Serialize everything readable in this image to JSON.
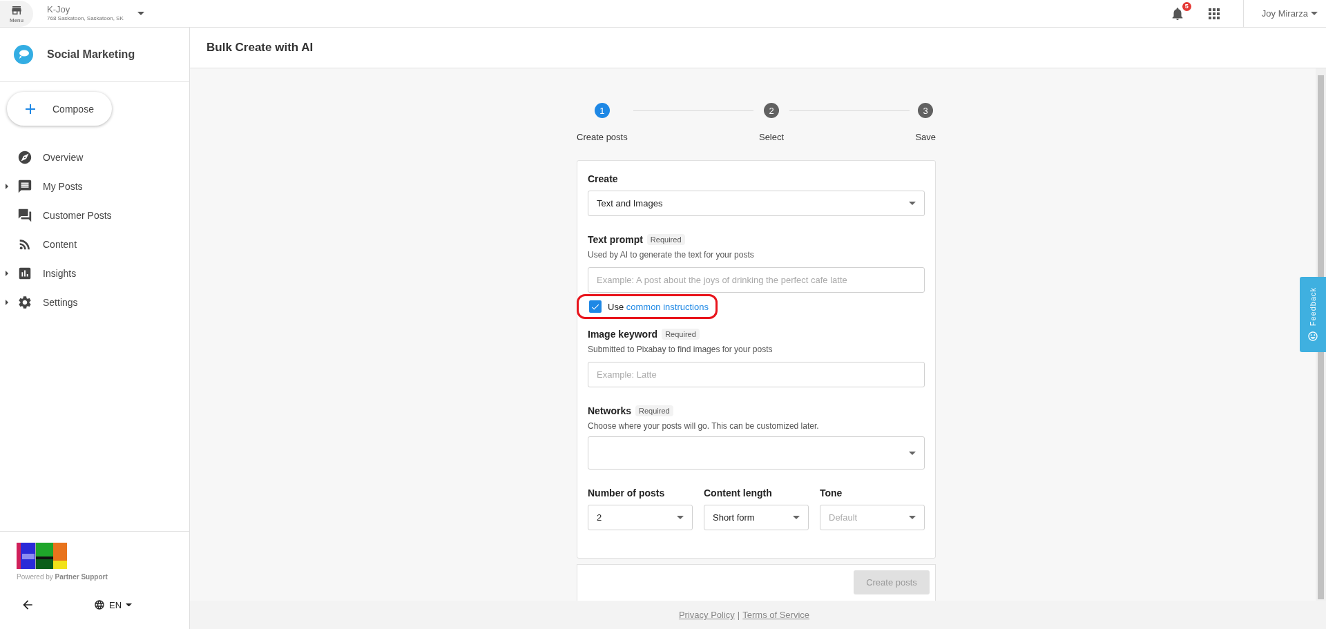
{
  "topbar": {
    "menu_label": "Menu",
    "business_name": "K-Joy",
    "business_address": "768 Saskatoon, Saskatoon, SK",
    "notification_count": "5",
    "user_name": "Joy Mirarza"
  },
  "sidebar": {
    "app_title": "Social Marketing",
    "compose_label": "Compose",
    "items": [
      {
        "label": "Overview",
        "expandable": false
      },
      {
        "label": "My Posts",
        "expandable": true
      },
      {
        "label": "Customer Posts",
        "expandable": false
      },
      {
        "label": "Content",
        "expandable": false
      },
      {
        "label": "Insights",
        "expandable": true
      },
      {
        "label": "Settings",
        "expandable": true
      }
    ],
    "powered_by": "Powered by **Partner Support**",
    "language": "EN"
  },
  "page": {
    "title": "Bulk Create with AI"
  },
  "stepper": [
    {
      "number": "1",
      "label": "Create posts",
      "active": true
    },
    {
      "number": "2",
      "label": "Select",
      "active": false
    },
    {
      "number": "3",
      "label": "Save",
      "active": false
    }
  ],
  "form": {
    "fields": [
      {
        "kind": "select",
        "label": "Create",
        "value": "Text and Images"
      },
      {
        "kind": "text",
        "label": "Text prompt",
        "badge": "Required",
        "helper": "Used by AI to generate the text for your posts",
        "placeholder": "Example: A post about the joys of drinking the perfect cafe latte"
      },
      {
        "kind": "checkbox",
        "prefix": "Use",
        "link": "common instructions",
        "checked": true,
        "highlighted": true
      },
      {
        "kind": "text",
        "label": "Image keyword",
        "badge": "Required",
        "helper": "Submitted to Pixabay to find images for your posts",
        "placeholder": "Example: Latte"
      },
      {
        "kind": "select",
        "label": "Networks",
        "badge": "Required",
        "helper": "Choose where your posts will go. This can be customized later."
      }
    ],
    "options_row": [
      {
        "label": "Number of posts",
        "value": "2"
      },
      {
        "label": "Content length",
        "value": "Short form"
      },
      {
        "label": "Tone",
        "placeholder": "Default"
      }
    ],
    "submit": {
      "label": "Create posts",
      "disabled": true
    }
  },
  "footer": {
    "links": [
      "Privacy Policy",
      "Terms of Service"
    ],
    "separator": "|"
  },
  "feedback_label": "Feedback"
}
